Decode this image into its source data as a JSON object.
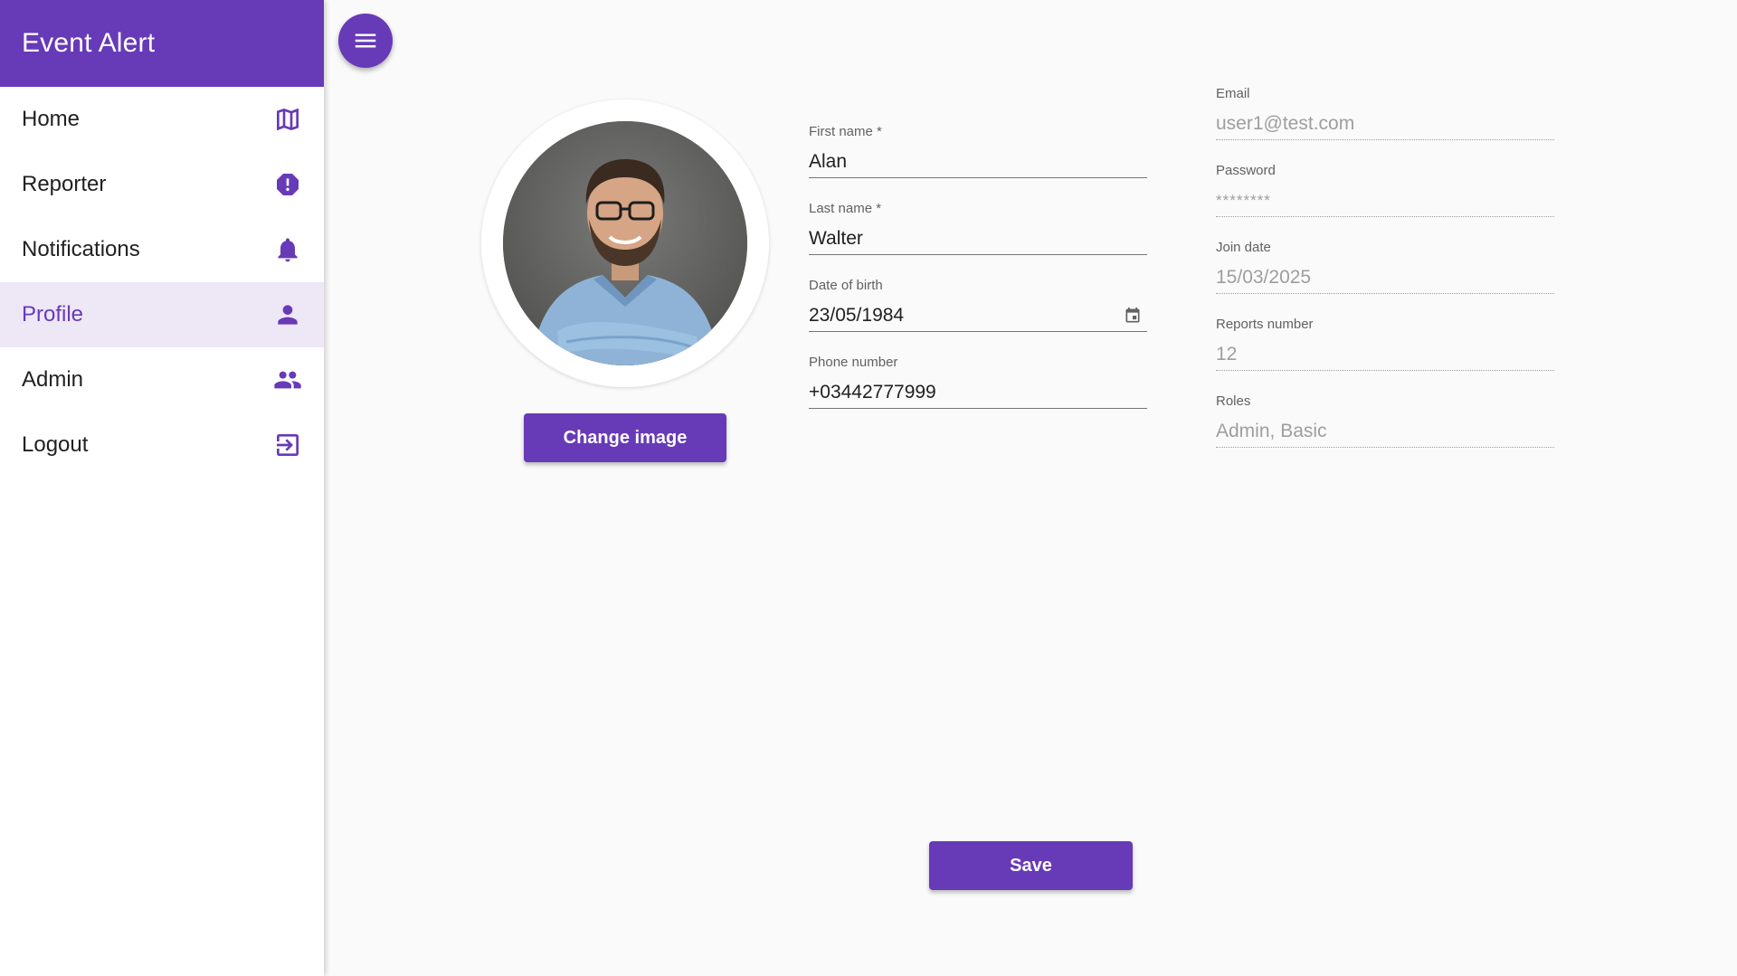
{
  "app": {
    "title": "Event Alert"
  },
  "sidebar": {
    "items": [
      {
        "label": "Home",
        "icon": "map-icon",
        "active": false
      },
      {
        "label": "Reporter",
        "icon": "report-icon",
        "active": false
      },
      {
        "label": "Notifications",
        "icon": "bell-icon",
        "active": false
      },
      {
        "label": "Profile",
        "icon": "person-icon",
        "active": true
      },
      {
        "label": "Admin",
        "icon": "people-icon",
        "active": false
      },
      {
        "label": "Logout",
        "icon": "exit-icon",
        "active": false
      }
    ]
  },
  "profile": {
    "change_image_label": "Change image",
    "save_label": "Save",
    "form": {
      "first_name": {
        "label": "First name *",
        "value": "Alan"
      },
      "last_name": {
        "label": "Last name *",
        "value": "Walter"
      },
      "date_of_birth": {
        "label": "Date of birth",
        "value": "23/05/1984"
      },
      "phone_number": {
        "label": "Phone number",
        "value": "+03442777999"
      }
    },
    "info": {
      "email": {
        "label": "Email",
        "value": "user1@test.com"
      },
      "password": {
        "label": "Password",
        "value": "********"
      },
      "join_date": {
        "label": "Join date",
        "value": "15/03/2025"
      },
      "reports_number": {
        "label": "Reports number",
        "value": "12"
      },
      "roles": {
        "label": "Roles",
        "value": "Admin, Basic"
      }
    }
  },
  "colors": {
    "primary": "#673ab7",
    "active_bg": "#ede7f6",
    "background": "#fafafa"
  }
}
